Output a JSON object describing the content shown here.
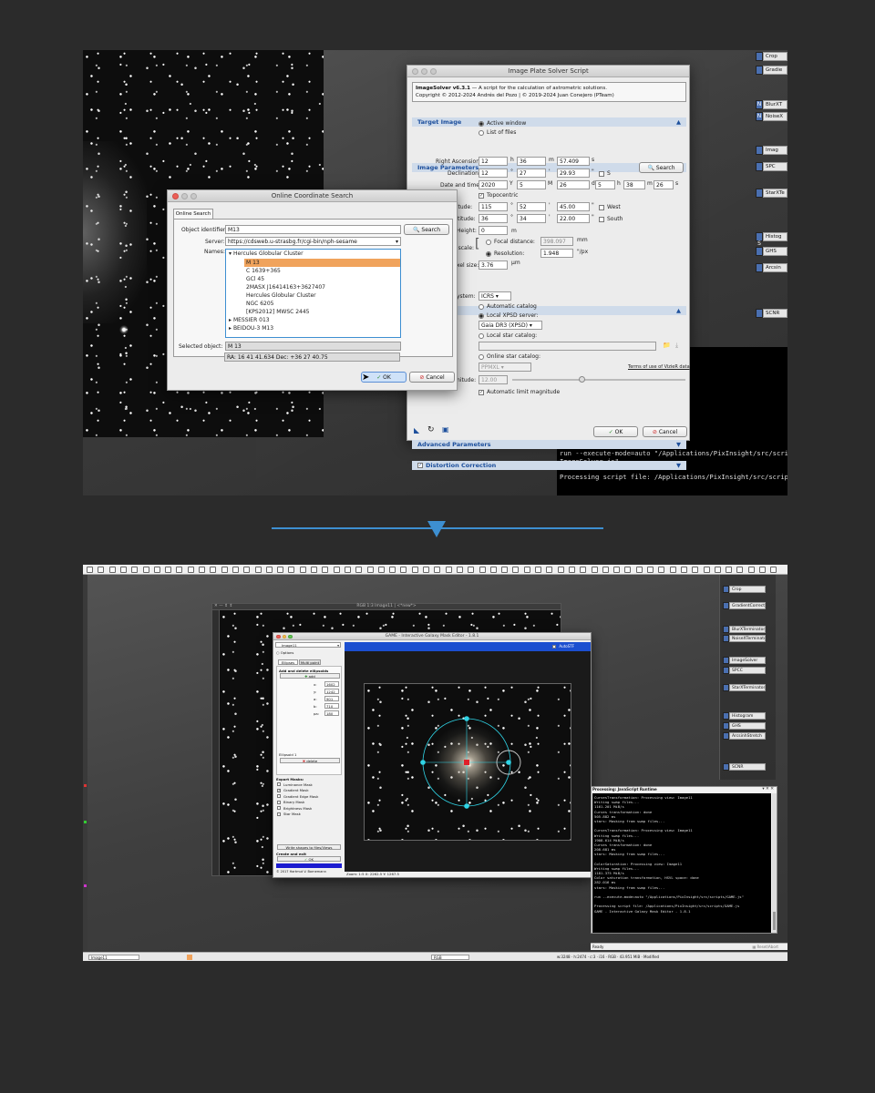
{
  "shot1": {
    "top_right_tabs": [
      "Crop",
      "Gradie",
      "BlurXT",
      "NoiseX",
      "Imag",
      "SPC",
      "StarXTe",
      "Histog",
      "GHS",
      "Arcsin",
      "SCNR"
    ],
    "top_right_icons": [
      "N",
      "S",
      "B"
    ],
    "online_search": {
      "title": "Online Coordinate Search",
      "tab": "Online Search",
      "object_identifier_label": "Object identifier:",
      "object_identifier_value": "M13",
      "search_button": "Search",
      "server_label": "Server:",
      "server_value": "https://cdsweb.u-strasbg.fr/cgi-bin/nph-sesame",
      "names_label": "Names:",
      "group_expanded": "Hercules Globular Cluster",
      "names": [
        "M 13",
        "C 1639+365",
        "GCl 45",
        "2MASX J16414163+3627407",
        "Hercules Globular Cluster",
        "NGC 6205",
        "[KPS2012] MWSC 2445"
      ],
      "group_collapsed": [
        "MESSIER 013",
        "BEIDOU-3 M13"
      ],
      "selected_object_label": "Selected object:",
      "selected_object_value": "M 13",
      "coords": "RA: 16 41 41.634   Dec: +36 27 40.75",
      "ok": "OK",
      "cancel": "Cancel"
    },
    "solver": {
      "title": "Image Plate Solver Script",
      "heading": "ImageSolver v6.3.1",
      "heading_rest": " — A script for the calculation of astrometric solutions.",
      "copyright": "Copyright © 2012-2024 Andrés del Pozo | © 2019-2024 Juan Conejero (PTeam)",
      "sect_target": "Target Image",
      "active_window": "Active window",
      "list_of_files": "List of files",
      "sect_params": "Image Parameters",
      "ra_label": "Right Ascension:",
      "ra": [
        "12",
        "36",
        "57.409"
      ],
      "ra_units": [
        "h",
        "m",
        "s"
      ],
      "dec_label": "Declination:",
      "dec": [
        "12",
        "27",
        "29.93"
      ],
      "dec_units": [
        "°",
        "'",
        "\""
      ],
      "dec_s": "S",
      "search": "Search",
      "date_label": "Date and time:",
      "date": [
        "2020",
        "5",
        "26",
        "5",
        "38",
        "26"
      ],
      "date_units": [
        "Y",
        "M",
        "d",
        "h",
        "m",
        "s"
      ],
      "topocentric": "Topocentric",
      "lon_label": "gitude:",
      "lon": [
        "115",
        "52",
        "45.00"
      ],
      "west": "West",
      "lat_label": "titude:",
      "lat": [
        "36",
        "34",
        "22.00"
      ],
      "south": "South",
      "height_label": "Height:",
      "height": "0",
      "height_unit": "m",
      "scale_label": "e scale:",
      "focal_label": "Focal distance:",
      "focal": "398.097",
      "focal_unit": "mm",
      "resolution_label": "Resolution:",
      "resolution": "1.948",
      "resolution_unit": "\"/px",
      "pixel_label": "xel size:",
      "pixel": "3.76",
      "pixel_unit": "μm",
      "sect_catalog": "s",
      "system_label": "ystem:",
      "system": "ICRS",
      "auto_catalog": "Automatic catalog",
      "local_xpsd": "Local XPSD server:",
      "xpsd_value": "Gaia DR3 (XPSD)",
      "local_star": "Local star catalog:",
      "online_star": "Online star catalog:",
      "ppmxl": "PPMXL",
      "vizier_terms": "Terms of use of VizieR data",
      "mag_label": "nitude:",
      "mag": "12.00",
      "auto_limit": "Automatic limit magnitude",
      "sect_advanced": "Advanced Parameters",
      "sect_distortion": "Distortion Correction",
      "ok": "OK",
      "cancel": "Cancel"
    },
    "console_lines": [
      "ligned with the reference",
      "",
      "s should be inside the ima",
      "should be within a factor",
      "",
      "alog through the VizieR se",
      "atalog with local XPSD dat",
      "",
      "e levels, bad tracking, or",
      "st some star detection par",
      "",
      "",
      "run --execute-mode=auto \"/Applications/PixInsight/src/script",
      "ImageSolver.js\"",
      "",
      "Processing script file: /Applications/PixInsight/src/scripts"
    ]
  },
  "shot2": {
    "right_tabs": [
      "Crop",
      "GradientCorrection",
      "BlurXTerminator",
      "NoiseXTerminator",
      "ImageSolver",
      "SPCC",
      "StarXTerminator",
      "Histogram",
      "GHS",
      "ArcsinhStretch",
      "SCNR"
    ],
    "image_title": "RGB 1:3 Image11 | <*new*>",
    "game_title": "GAME - Interactive Galaxy Mask Editor - 1.8.1",
    "image_select": "Image11",
    "options": "Options",
    "tabs": [
      "Ellipses",
      "Multi point"
    ],
    "add_delete": "Add and delete ellipsoids",
    "add": "add",
    "fields": [
      {
        "k": "x:",
        "v": "1602"
      },
      {
        "k": "y:",
        "v": "1242"
      },
      {
        "k": "a:",
        "v": "901"
      },
      {
        "k": "b:",
        "v": "710"
      },
      {
        "k": "pa:",
        "v": "180"
      }
    ],
    "ellipsoid": "Ellipsoid 1",
    "delete": "delete",
    "export_masks": "Export Masks:",
    "masks": [
      {
        "label": "Luminance Mask",
        "checked": false
      },
      {
        "label": "Gradient Mask",
        "checked": true
      },
      {
        "label": "Gradient Edge Mask",
        "checked": false
      },
      {
        "label": "Binary Mask",
        "checked": false
      },
      {
        "label": "Brightness Mask",
        "checked": false
      },
      {
        "label": "Star Mask",
        "checked": false
      }
    ],
    "write_shapes": "Write shapes to files/Views",
    "create_exit": "Create and exit",
    "ok": "OK",
    "copyright": "© 2017 Hartmut V. Bornemann",
    "autostf": "AutoSTF",
    "zoom": "Zoom: 1:5   X: 2262.5   Y: 1267.5",
    "runtime_title": "Processing: JavaScript Runtime",
    "runtime_lines": [
      "CurvesTransformation: Processing view: Image11",
      "Writing swap files...",
      "1161.201 MiB/s",
      "Curves transformation: done",
      "505.882 ms",
      "stars: Masking from swap files...",
      "",
      "CurvesTransformation: Processing view: Image11",
      "Writing swap files...",
      "1908.614 MiB/s",
      "Curves transformation: done",
      "208.681 ms",
      "stars: Masking from swap files...",
      "",
      "ColorSaturation: Processing view: Image11",
      "Writing swap files...",
      "1181.375 MiB/s",
      "Color saturation transformation, HSVL space: done",
      "282.016 ms",
      "stars: Masking from swap files...",
      "",
      "run --execute-mode=auto \"/Applications/PixInsight/src/scripts/GAME.js\"",
      "",
      "Processing script file: /Applications/PixInsight/src/scripts/GAME.js",
      "GAME - Interactive Galaxy Mask Editor - 1.8.1"
    ],
    "status_ready": "Ready",
    "status_right": "w:3248 · h:2474 · c:3 · i16 · RGB · 43.951 MiB · Modified",
    "status_view": "Image11",
    "status_rgb": "RGB"
  },
  "colors": {
    "accent": "#3d8fd1",
    "highlight": "#f0a35c",
    "section": "#cfdbea",
    "section_text": "#1d4f9c",
    "game_cyan": "#2fd4e6",
    "game_red": "#e0202a"
  }
}
